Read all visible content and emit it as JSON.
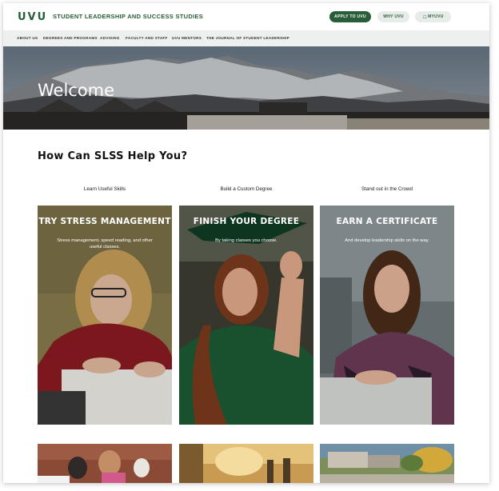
{
  "header": {
    "logo": "UVU",
    "department": "STUDENT LEADERSHIP AND SUCCESS STUDIES",
    "apply_label": "APPLY TO UVU",
    "why_label": "WHY UVU",
    "my_label": "MYUVU"
  },
  "nav": {
    "items": [
      {
        "label": "ABOUT US"
      },
      {
        "label": "DEGREES AND PROGRAMS"
      },
      {
        "label": "ADVISING"
      },
      {
        "label": "FACULTY AND STAFF"
      },
      {
        "label": "UVU MENTORS"
      },
      {
        "label": "THE JOURNAL OF STUDENT LEADERSHIP"
      }
    ]
  },
  "hero": {
    "title": "Welcome"
  },
  "help": {
    "title": "How Can SLSS Help You?",
    "columns": [
      {
        "label": "Learn Useful Skills",
        "card_title": "TRY STRESS MANAGEMENT",
        "card_text": "Stress management, speed reading, and other useful classes."
      },
      {
        "label": "Build a Custom Degree",
        "card_title": "FINISH YOUR DEGREE",
        "card_text": "By taking classes you choose."
      },
      {
        "label": "Stand out in the Crowd",
        "card_title": "EARN A CERTIFICATE",
        "card_text": "And develop leadership skills on the way."
      }
    ]
  },
  "colors": {
    "brand_green": "#275d38",
    "nav_bg": "#eef0ef"
  }
}
